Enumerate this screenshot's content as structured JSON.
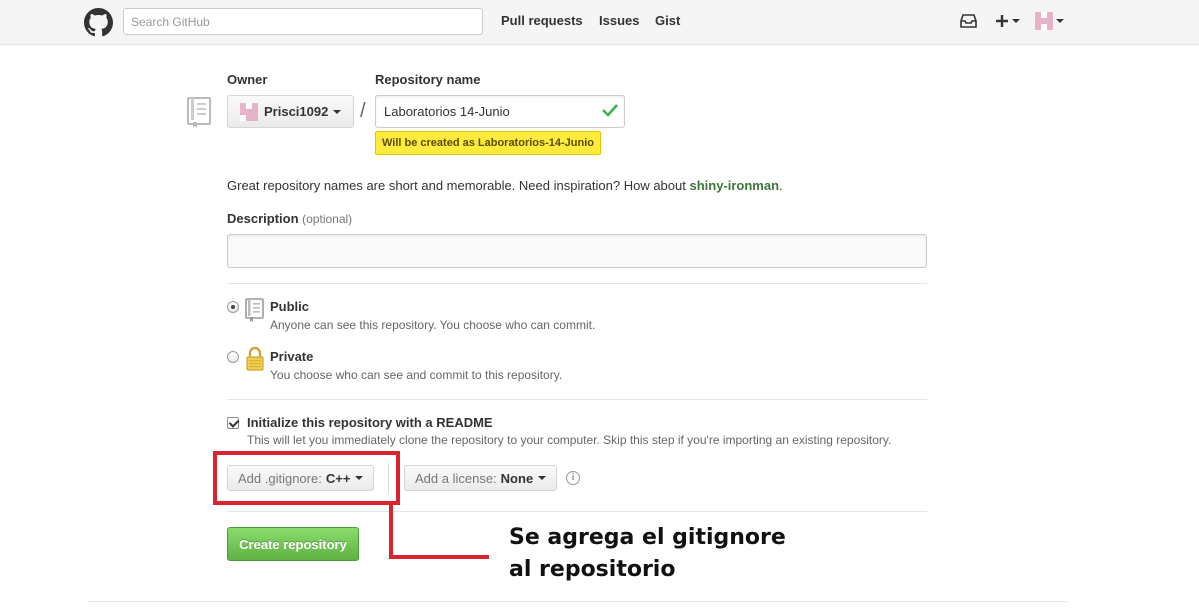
{
  "header": {
    "search_placeholder": "Search GitHub",
    "nav": [
      "Pull requests",
      "Issues",
      "Gist"
    ]
  },
  "form": {
    "owner_label": "Owner",
    "owner_value": "Prisci1092",
    "repo_name_label": "Repository name",
    "repo_name_value": "Laboratorios 14-Junio",
    "tooltip": "Will be created as Laboratorios-14-Junio",
    "hint_text": "Great repository names are short and memorable. Need inspiration? How about ",
    "hint_suggestion": "shiny-ironman",
    "hint_end": ".",
    "description_label": "Description",
    "description_optional": "(optional)",
    "public": {
      "title": "Public",
      "desc": "Anyone can see this repository. You choose who can commit.",
      "selected": true
    },
    "private": {
      "title": "Private",
      "desc": "You choose who can see and commit to this repository.",
      "selected": false
    },
    "readme": {
      "title": "Initialize this repository with a README",
      "desc": "This will let you immediately clone the repository to your computer. Skip this step if you're importing an existing repository.",
      "checked": true
    },
    "gitignore": {
      "label": "Add .gitignore:",
      "value": "C++"
    },
    "license": {
      "label": "Add a license:",
      "value": "None"
    },
    "create_button": "Create repository"
  },
  "annotation": {
    "text": "Se agrega el gitignore\nal repositorio",
    "color": "#d9232e"
  },
  "colors": {
    "accent_green": "#60b044",
    "tooltip_yellow": "#ffeb3b",
    "suggestion_green": "#3c763d"
  }
}
